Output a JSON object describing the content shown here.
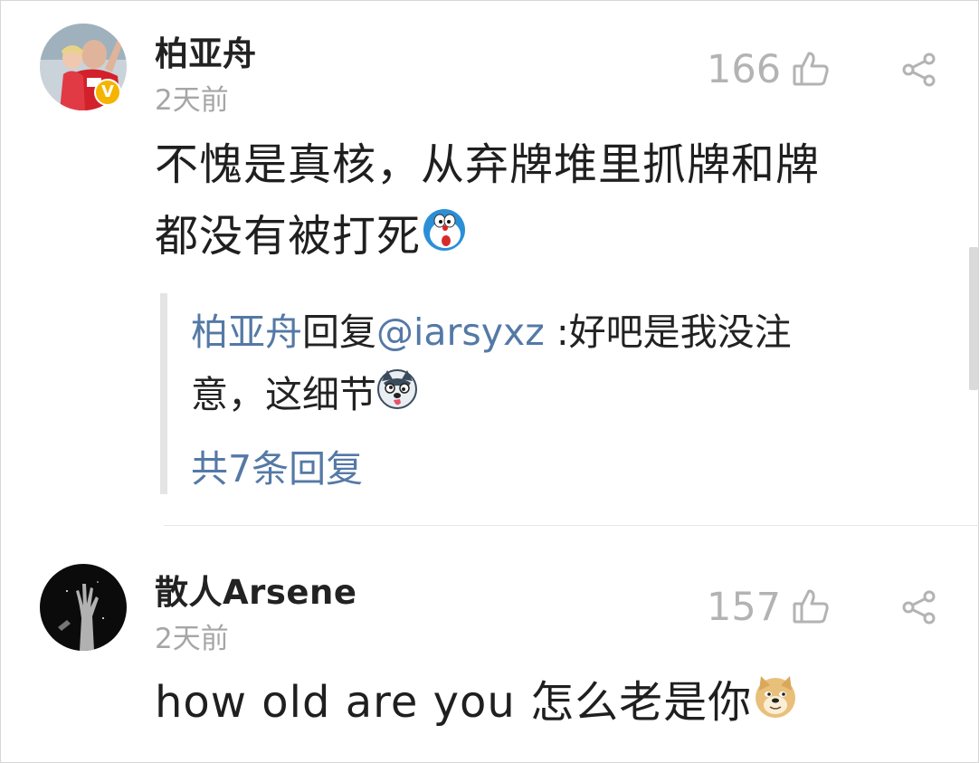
{
  "comments": [
    {
      "username": "柏亚舟",
      "time": "2天前",
      "likes": "166",
      "verified": true,
      "verified_badge": "V",
      "text_line1": "不愧是真核，从弃牌堆里抓牌和牌",
      "text_line2": "都没有被打死",
      "text_emoji": "doraemon-emoji",
      "reply": {
        "author": "柏亚舟",
        "action": "回复",
        "mention": "@iarsyxz",
        "text_line1": " :好吧是我没注",
        "text_line2": "意，这细节",
        "emoji": "husky-emoji"
      },
      "more_replies": "共7条回复"
    },
    {
      "username": "散人Arsene",
      "time": "2天前",
      "likes": "157",
      "text_line1": "how old are you 怎么老是你",
      "text_emoji": "doge-emoji"
    }
  ],
  "icons": {
    "like": "thumbs-up-icon",
    "share": "share-icon"
  },
  "colors": {
    "link": "#5479a6",
    "meta": "#a6a6a6",
    "badge": "#f5b400"
  }
}
